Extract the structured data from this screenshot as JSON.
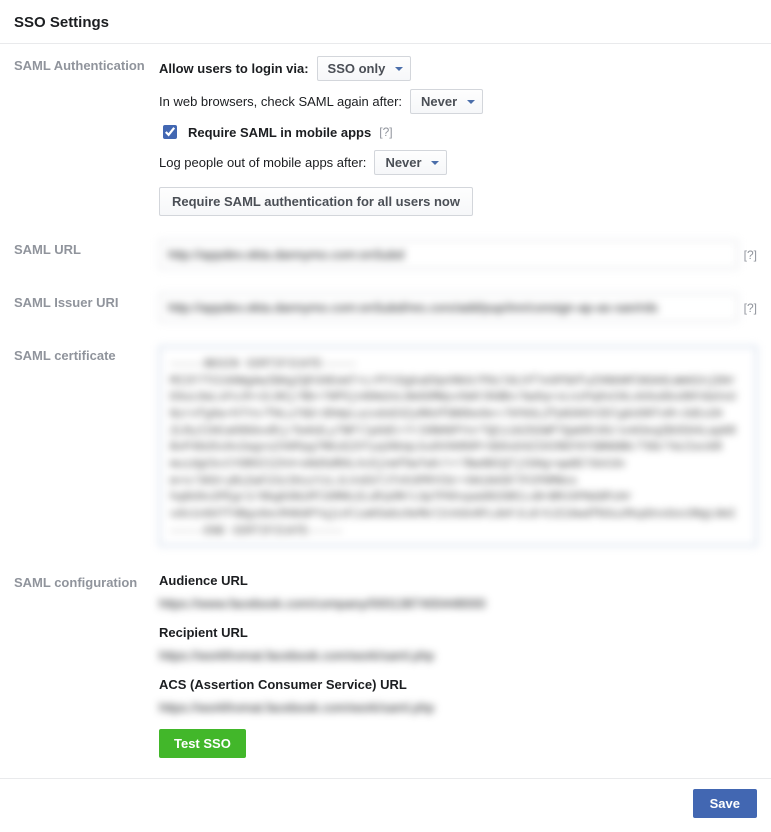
{
  "page": {
    "title": "SSO Settings"
  },
  "sections": {
    "saml_auth": {
      "label": "SAML Authentication",
      "allow_login_text": "Allow users to login via:",
      "allow_login_value": "SSO only",
      "recheck_text": "In web browsers, check SAML again after:",
      "recheck_value": "Never",
      "require_mobile_label": "Require SAML in mobile apps",
      "require_mobile_help": "[?]",
      "logout_text": "Log people out of mobile apps after:",
      "logout_value": "Never",
      "require_all_btn": "Require SAML authentication for all users now"
    },
    "saml_url": {
      "label": "SAML URL",
      "value": "http://appdev.okta.dannymo.com:onSubd",
      "help": "[?]"
    },
    "saml_issuer": {
      "label": "SAML Issuer URI",
      "value": "http://appdev.okta.dannymo.com:onSubd/res.cors/add/pup/inn/consign-ap-as-san/rds",
      "help": "[?]"
    },
    "saml_cert": {
      "label": "SAML certificate",
      "value": "-----BEGIN CERTIFICATE-----\nMIIF7TCCA9WgAwIBAgIQFd4EemT+LrPYtDgkaDSpVNkO/P8zl6Lhf7eSP5DfuZXN0AMlNSA9LWm02njDHr\nE6uL0aLsFoJh+2L90j/Nb+7HP5jn80m2eL8mSOMWyv5mhlRdBn/Gw5q+xLnzPq9sCHLok0uGbs8NYdaXxU\nNzrnfg9a+hTYn/fHLu7GErdhHpLuzxdoEXZyRKUfOB0be9e+/hFKGLZfpN3HSYZDlgkU5RTvR+JUEv2H\nZLRyIIHCa09bbvdhj/5eKdLy7NPllpOdC+7rI0NH6PYnrTQCziKZ92WP7QaKRt0S/xnH3eqZB3504LapKR\nBvP4bU5s9v2agvsZ49Ppg7RKzEZXTyq38UqLkuOVXKROPrGDOxD4ZI0IREF6YSBN6BK/T0D/YmJIecKR\nmuidgCkcCYOROIIZX4+eNdSdROLXxSjnmfOwTwh/rr7Bw9BIQTjIGHg+qwDE7doCdv\nm+n/36SryBiZwF23zIKszYzLJLVxEkTJTnh3PRYCbr+SHiN4SF7FCP0MNns\nhq8U9v2PEgr2/8bgbSNiMT20MHLELdFpOM/LSpTP6hspaGR2SRCLvB+BMJXPNddPzHr\nvdv1nOUTf4Bgs6ecM4KAPYqjLHliaK5abz9eMelInXdv0FLdeFJLdrXJZ16wdfN3uzMspDnxGocONgL8mI\n-----END CERTIFICATE-----"
    },
    "saml_config": {
      "label": "SAML configuration",
      "audience_label": "Audience URL",
      "audience_value": "https://www.facebook.com/company/0001387400448000",
      "recipient_label": "Recipient URL",
      "recipient_value": "https://workfromat.facebook.com/work/saml.php",
      "acs_label": "ACS (Assertion Consumer Service) URL",
      "acs_value": "https://workfromat.facebook.com/work/saml.php",
      "test_btn": "Test SSO"
    }
  },
  "footer": {
    "save": "Save"
  }
}
